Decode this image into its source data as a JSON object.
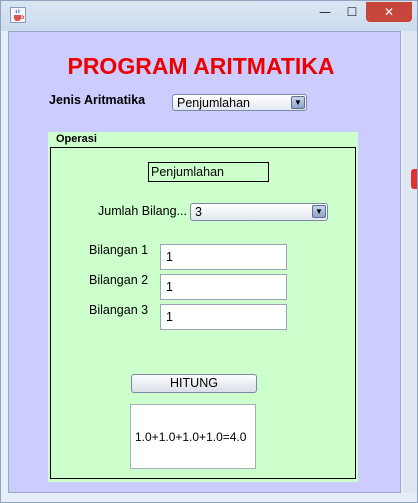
{
  "window": {
    "title_icon": "java-cup-icon",
    "minimize_glyph": "—",
    "maximize_glyph": "☐",
    "close_glyph": "✕"
  },
  "header": {
    "title": "PROGRAM ARITMATIKA",
    "jenis_label": "Jenis Aritmatika",
    "jenis_value": "Penjumlahan"
  },
  "panel": {
    "title": "Operasi",
    "operation_label": "Penjumlahan",
    "jumlah_label": "Jumlah Bilang...",
    "jumlah_value": "3",
    "inputs": [
      {
        "label": "Bilangan 1",
        "value": "1"
      },
      {
        "label": "Bilangan 2",
        "value": "1"
      },
      {
        "label": "Bilangan 3",
        "value": "1"
      }
    ],
    "hitung_label": "HITUNG",
    "result": "1.0+1.0+1.0+1.0=4.0"
  },
  "colors": {
    "title_red": "#ee0000",
    "content_bg": "#ccccff",
    "panel_bg": "#ccffcc"
  }
}
